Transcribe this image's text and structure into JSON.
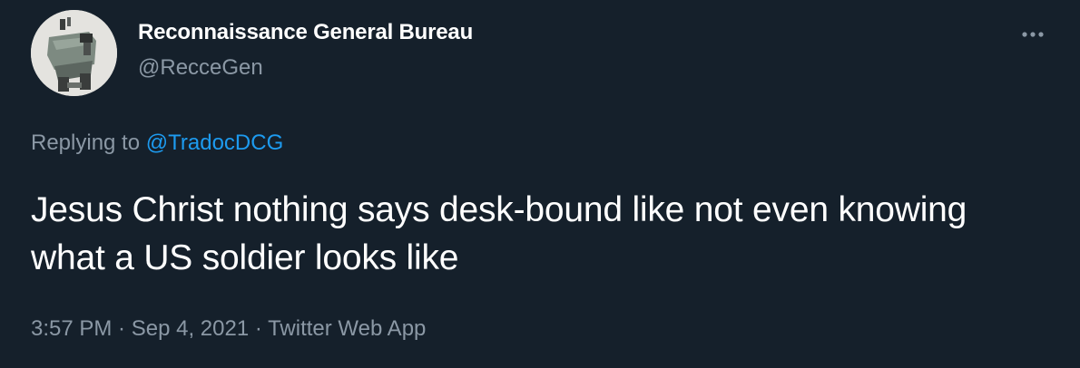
{
  "author": {
    "display_name": "Reconnaissance General Bureau",
    "handle": "@RecceGen"
  },
  "reply": {
    "prefix": "Replying to ",
    "mention": "@TradocDCG"
  },
  "tweet": {
    "text": "Jesus Christ nothing says desk-bound like not even knowing what a US soldier looks like"
  },
  "meta": {
    "time": "3:57 PM",
    "separator": " · ",
    "date": "Sep 4, 2021",
    "source": "Twitter Web App"
  },
  "icons": {
    "more": "more-horizontal-icon"
  },
  "colors": {
    "background": "#15202b",
    "primary_text": "#ffffff",
    "secondary_text": "#8b98a5",
    "link": "#1d9bf0"
  }
}
